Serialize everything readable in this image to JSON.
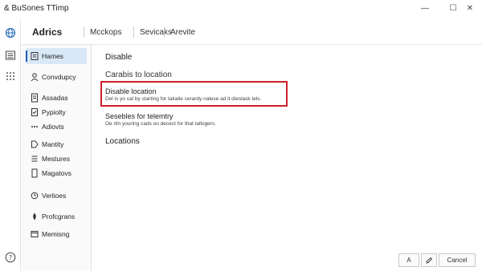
{
  "window": {
    "title": "& BuSones TTimp",
    "minimize_glyph": "—",
    "maximize_glyph": "☐",
    "close_glyph": "✕"
  },
  "rail": {
    "icons": [
      "globe-icon",
      "list-icon",
      "grid-icon",
      "help-icon"
    ]
  },
  "header": {
    "title": "Adrics",
    "tabs": [
      "Mcckops",
      "Sevicaks",
      "Arevite"
    ]
  },
  "sidebar": {
    "items": [
      {
        "label": "Hames",
        "icon": "home-icon",
        "selected": true
      },
      {
        "label": "Convdupcy",
        "icon": "user-icon",
        "selected": false
      },
      {
        "label": "Assadas",
        "icon": "document-icon",
        "selected": false
      },
      {
        "label": "Pypiolty",
        "icon": "checklist-icon",
        "selected": false
      },
      {
        "label": "Adiovts",
        "icon": "dots-icon",
        "selected": false
      },
      {
        "label": "Mantity",
        "icon": "tag-icon",
        "selected": false
      },
      {
        "label": "Mestures",
        "icon": "list-icon",
        "selected": false
      },
      {
        "label": "Magatovs",
        "icon": "page-icon",
        "selected": false
      },
      {
        "label": "Verlioes",
        "icon": "clock-icon",
        "selected": false
      },
      {
        "label": "Profcgrans",
        "icon": "drop-icon",
        "selected": false
      },
      {
        "label": "Memisng",
        "icon": "window-icon",
        "selected": false
      }
    ]
  },
  "content": {
    "section_title": "Disable",
    "subheading": "Carabis to location",
    "highlighted_option": {
      "title": "Disable location",
      "description": "Del is yo cal by starting for takalie cerardy nalese ad it dieslask tels.",
      "highlight_color": "#d0202a"
    },
    "option2": {
      "title": "Sesebles for telemtry",
      "description": "Oe rlin youring cads oo decect for that tallogers."
    },
    "locations_heading": "Locations"
  },
  "footer": {
    "buttons": [
      {
        "label": "A",
        "icon": "text-icon"
      },
      {
        "label": "",
        "icon": "pencil-icon"
      },
      {
        "label": "Cancel",
        "icon": ""
      }
    ]
  },
  "colors": {
    "accent": "#1a5fb4",
    "selected_bg": "#d9e8f6",
    "highlight": "#d0202a"
  }
}
